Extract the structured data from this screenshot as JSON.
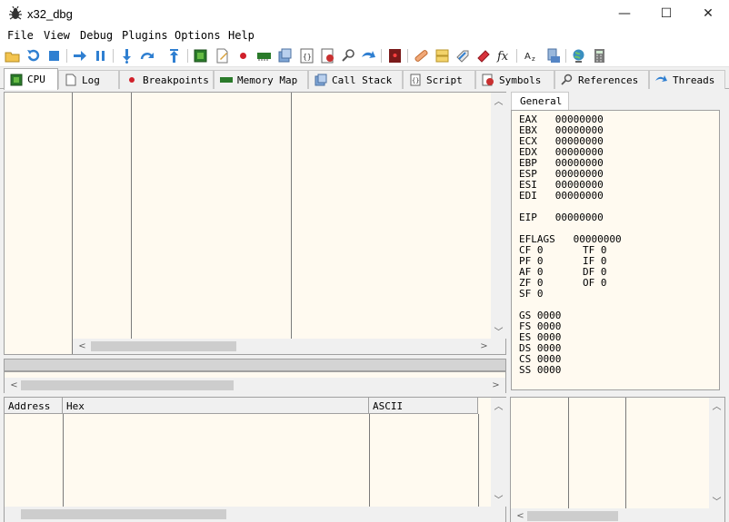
{
  "window": {
    "title": "x32_dbg",
    "app_icon": "bug-icon",
    "minimize": "—",
    "maximize": "☐",
    "close": "✕"
  },
  "menu": [
    "File",
    "View",
    "Debug",
    "Plugins",
    "Options",
    "Help"
  ],
  "toolbar": [
    "open-icon",
    "restart-icon",
    "stop-icon",
    "run-icon",
    "pause-icon",
    "step-into-icon",
    "step-over-icon",
    "execute-till-return-icon",
    "cpu-icon",
    "patch-icon",
    "breakpoint-icon",
    "memory-icon",
    "threads-icon",
    "log-icon",
    "notes-icon",
    "search-icon",
    "goto-icon",
    "trace-icon",
    "patch-file-icon",
    "comments-icon",
    "labels-icon",
    "bookmarks-icon",
    "functions-icon",
    "font-icon",
    "dll-icon",
    "globe-icon",
    "calculator-icon"
  ],
  "tabs": [
    {
      "label": "CPU",
      "icon": "cpu-icon"
    },
    {
      "label": "Log",
      "icon": "log-icon"
    },
    {
      "label": "Breakpoints",
      "icon": "breakpoint-icon"
    },
    {
      "label": "Memory Map",
      "icon": "memory-icon"
    },
    {
      "label": "Call Stack",
      "icon": "call-stack-icon"
    },
    {
      "label": "Script",
      "icon": "script-icon"
    },
    {
      "label": "Symbols",
      "icon": "symbols-icon"
    },
    {
      "label": "References",
      "icon": "references-icon"
    },
    {
      "label": "Threads",
      "icon": "threads-icon"
    }
  ],
  "registers": {
    "tab": "General",
    "general": [
      {
        "name": "EAX",
        "value": "00000000"
      },
      {
        "name": "EBX",
        "value": "00000000"
      },
      {
        "name": "ECX",
        "value": "00000000"
      },
      {
        "name": "EDX",
        "value": "00000000"
      },
      {
        "name": "EBP",
        "value": "00000000"
      },
      {
        "name": "ESP",
        "value": "00000000"
      },
      {
        "name": "ESI",
        "value": "00000000"
      },
      {
        "name": "EDI",
        "value": "00000000"
      }
    ],
    "eip": {
      "name": "EIP",
      "value": "00000000"
    },
    "eflags": {
      "name": "EFLAGS",
      "value": "00000000"
    },
    "flags": [
      {
        "left": "CF 0",
        "right": "TF 0"
      },
      {
        "left": "PF 0",
        "right": "IF 0"
      },
      {
        "left": "AF 0",
        "right": "DF 0"
      },
      {
        "left": "ZF 0",
        "right": "OF 0"
      },
      {
        "left": "SF 0",
        "right": ""
      }
    ],
    "segments": [
      "GS 0000",
      "FS 0000",
      "ES 0000",
      "DS 0000",
      "CS 0000",
      "SS 0000"
    ]
  },
  "dump": {
    "columns": [
      "Address",
      "Hex",
      "ASCII"
    ]
  }
}
